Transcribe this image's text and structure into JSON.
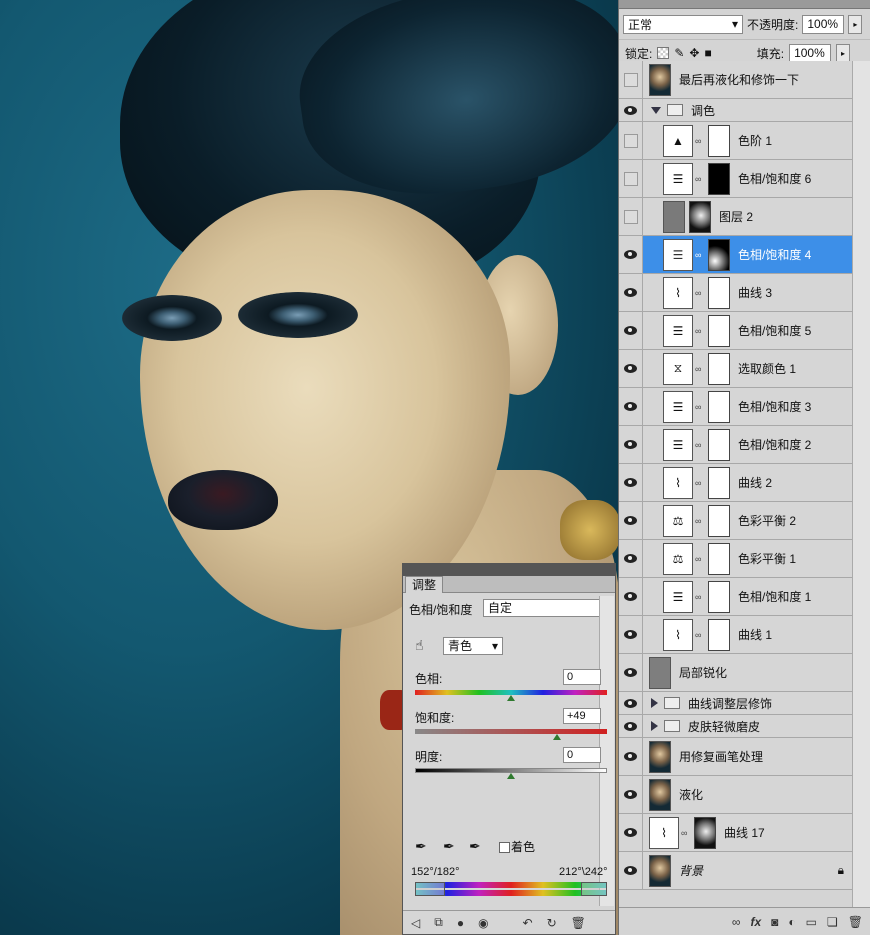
{
  "layers_panel": {
    "blend_mode": "正常",
    "opacity_label": "不透明度:",
    "opacity_value": "100%",
    "lock_label": "锁定:",
    "fill_label": "填充:",
    "fill_value": "100%",
    "layers": [
      {
        "name": "最后再液化和修饰一下",
        "visible": false,
        "type": "photo"
      },
      {
        "name": "调色",
        "visible": true,
        "type": "group-open"
      },
      {
        "name": "色阶 1",
        "visible": false,
        "type": "adjust"
      },
      {
        "name": "色相/饱和度 6",
        "visible": false,
        "type": "adjust"
      },
      {
        "name": "图层 2",
        "visible": false,
        "type": "layer"
      },
      {
        "name": "色相/饱和度 4",
        "visible": true,
        "type": "adjust",
        "selected": true
      },
      {
        "name": "曲线 3",
        "visible": true,
        "type": "adjust"
      },
      {
        "name": "色相/饱和度 5",
        "visible": true,
        "type": "adjust"
      },
      {
        "name": "选取颜色 1",
        "visible": true,
        "type": "adjust"
      },
      {
        "name": "色相/饱和度 3",
        "visible": true,
        "type": "adjust"
      },
      {
        "name": "色相/饱和度 2",
        "visible": true,
        "type": "adjust"
      },
      {
        "name": "曲线 2",
        "visible": true,
        "type": "adjust"
      },
      {
        "name": "色彩平衡 2",
        "visible": true,
        "type": "adjust"
      },
      {
        "name": "色彩平衡 1",
        "visible": true,
        "type": "adjust"
      },
      {
        "name": "色相/饱和度 1",
        "visible": true,
        "type": "adjust"
      },
      {
        "name": "曲线 1",
        "visible": true,
        "type": "adjust"
      },
      {
        "name": "局部锐化",
        "visible": true,
        "type": "layer"
      },
      {
        "name": "曲线调整层修饰",
        "visible": true,
        "type": "group-closed"
      },
      {
        "name": "皮肤轻微磨皮",
        "visible": true,
        "type": "group-closed"
      },
      {
        "name": "用修复画笔处理",
        "visible": true,
        "type": "photo"
      },
      {
        "name": "液化",
        "visible": true,
        "type": "photo"
      },
      {
        "name": "曲线 17",
        "visible": true,
        "type": "adjust"
      },
      {
        "name": "背景",
        "visible": true,
        "type": "photo"
      }
    ],
    "footer_icons": [
      "link-icon",
      "fx-icon",
      "mask-icon",
      "adjustment-icon",
      "folder-icon",
      "new-layer-icon",
      "trash-icon"
    ]
  },
  "adjust_panel": {
    "tab": "调整",
    "adjustment_type": "色相/饱和度",
    "preset": "自定",
    "channel": "青色",
    "hue_label": "色相:",
    "hue_value": "0",
    "saturation_label": "饱和度:",
    "saturation_value": "+49",
    "lightness_label": "明度:",
    "lightness_value": "0",
    "colorize_label": "着色",
    "range_left": "152°/182°",
    "range_right": "212°\\242°"
  }
}
